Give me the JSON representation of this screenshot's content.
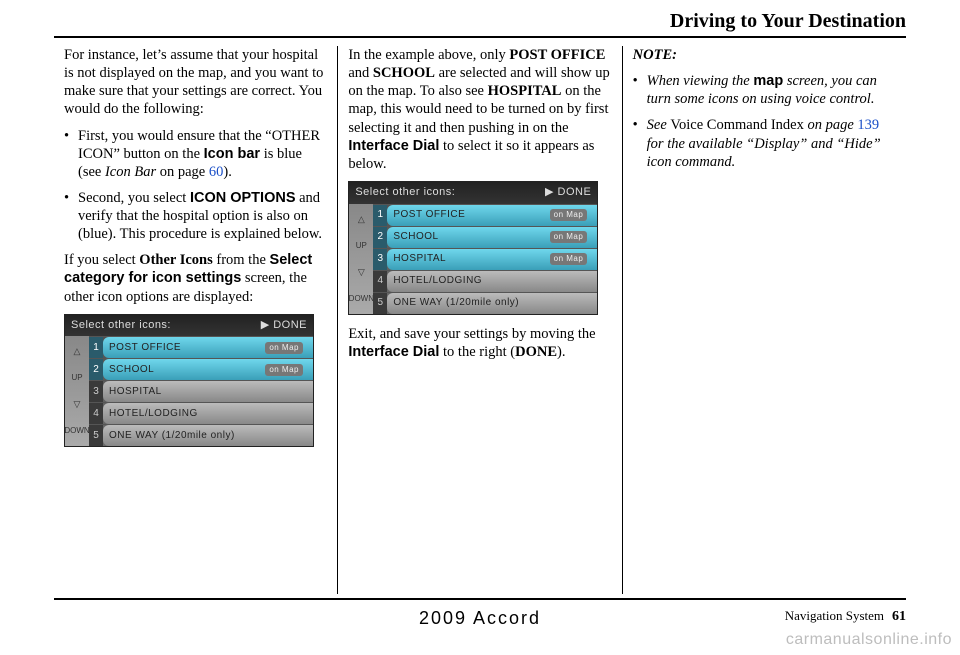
{
  "header": {
    "section_title": "Driving to Your Destination"
  },
  "col1": {
    "intro": "For instance, let’s assume that your hospital is not displayed on the map, and you want to make sure that your settings are correct. You would do the following:",
    "bullets": [
      {
        "pre": "First, you would ensure that the “OTHER ICON” button on the ",
        "sans1": "Icon bar",
        "mid": " is blue (see ",
        "ital": "Icon Bar",
        "post_ital": " on page ",
        "link": "60",
        "end": ")."
      },
      {
        "pre": "Second, you select ",
        "sans1": "ICON OPTIONS",
        "mid": " and verify that the hospital option is also on (blue). This procedure is explained below.",
        "ital": "",
        "post_ital": "",
        "link": "",
        "end": ""
      }
    ],
    "after_bullets_pre": "If you select ",
    "after_bullets_bold": "Other Icons",
    "after_bullets_mid": " from the ",
    "after_bullets_sans": "Select category for icon settings",
    "after_bullets_post": " screen, the other icon options are displayed:",
    "screenshot": {
      "title": "Select other icons:",
      "done": "▶ DONE",
      "rows": [
        {
          "num": "1",
          "label": "POST OFFICE",
          "tag": "on Map",
          "sel": true
        },
        {
          "num": "2",
          "label": "SCHOOL",
          "tag": "on Map",
          "sel": true
        },
        {
          "num": "3",
          "label": "HOSPITAL",
          "tag": "",
          "sel": false
        },
        {
          "num": "4",
          "label": "HOTEL/LODGING",
          "tag": "",
          "sel": false
        },
        {
          "num": "5",
          "label": "ONE WAY (1/20mile only)",
          "tag": "",
          "sel": false
        }
      ],
      "left_labels": {
        "up": "UP",
        "down": "DOWN"
      }
    }
  },
  "col2": {
    "p1_pre": "In the example above, only ",
    "p1_b1": "POST OFFICE",
    "p1_mid1": " and ",
    "p1_b2": "SCHOOL",
    "p1_mid2": " are selected and will show up on the map. To also see ",
    "p1_b3": "HOSPITAL",
    "p1_mid3": " on the map, this would need to be turned on by first selecting it and then pushing in on the ",
    "p1_sans": "Interface Dial",
    "p1_end": " to select it so it appears as below.",
    "screenshot": {
      "title": "Select other icons:",
      "done": "▶ DONE",
      "rows": [
        {
          "num": "1",
          "label": "POST OFFICE",
          "tag": "on Map",
          "sel": true
        },
        {
          "num": "2",
          "label": "SCHOOL",
          "tag": "on Map",
          "sel": true
        },
        {
          "num": "3",
          "label": "HOSPITAL",
          "tag": "on Map",
          "sel": true
        },
        {
          "num": "4",
          "label": "HOTEL/LODGING",
          "tag": "",
          "sel": false
        },
        {
          "num": "5",
          "label": "ONE WAY (1/20mile only)",
          "tag": "",
          "sel": false
        }
      ],
      "left_labels": {
        "up": "UP",
        "down": "DOWN"
      }
    },
    "p2_pre": "Exit, and save your settings by moving the ",
    "p2_sans": "Interface Dial",
    "p2_mid": " to the right (",
    "p2_bold": "DONE",
    "p2_end": ")."
  },
  "col3": {
    "note_label": "NOTE:",
    "bullets": [
      {
        "pre_i": "When viewing the ",
        "sans": "map",
        "post_i": " screen, you can turn some icons on using voice control."
      },
      {
        "pre_i": "See ",
        "roman": "Voice Command Index",
        "mid_i": " on page ",
        "link": "139",
        "post_i": " for the available “Display” and “Hide” icon command."
      }
    ]
  },
  "footer": {
    "center": "2009  Accord",
    "right_label": "Navigation System",
    "page_num": "61"
  },
  "watermark": "carmanualsonline.info"
}
